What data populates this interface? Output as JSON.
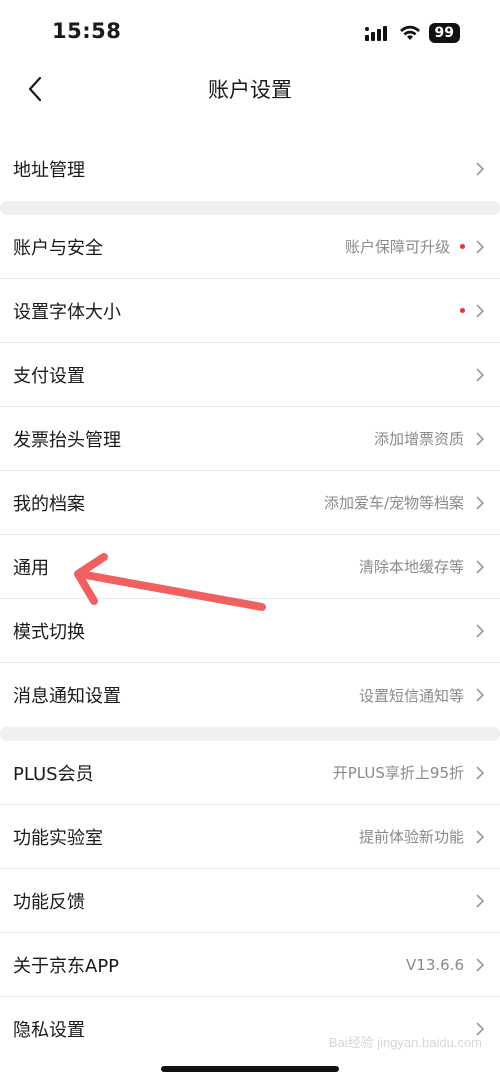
{
  "status": {
    "time": "15:58",
    "battery": "99"
  },
  "nav": {
    "title": "账户设置"
  },
  "groups": [
    {
      "rows": [
        {
          "label": "地址管理",
          "value": "",
          "dot": false
        }
      ]
    },
    {
      "rows": [
        {
          "label": "账户与安全",
          "value": "账户保障可升级",
          "dot": true
        },
        {
          "label": "设置字体大小",
          "value": "",
          "dot": true
        },
        {
          "label": "支付设置",
          "value": "",
          "dot": false
        },
        {
          "label": "发票抬头管理",
          "value": "添加增票资质",
          "dot": false
        },
        {
          "label": "我的档案",
          "value": "添加爱车/宠物等档案",
          "dot": false
        },
        {
          "label": "通用",
          "value": "清除本地缓存等",
          "dot": false
        },
        {
          "label": "模式切换",
          "value": "",
          "dot": false
        },
        {
          "label": "消息通知设置",
          "value": "设置短信通知等",
          "dot": false
        }
      ]
    },
    {
      "rows": [
        {
          "label": "PLUS会员",
          "value": "开PLUS享折上95折",
          "dot": false
        },
        {
          "label": "功能实验室",
          "value": "提前体验新功能",
          "dot": false
        },
        {
          "label": "功能反馈",
          "value": "",
          "dot": false
        },
        {
          "label": "关于京东APP",
          "value": "V13.6.6",
          "dot": false
        },
        {
          "label": "隐私设置",
          "value": "",
          "dot": false
        }
      ]
    }
  ],
  "colors": {
    "accent_red": "#e8313c",
    "arrow": "#f06060",
    "separator": "#f0f0f0"
  },
  "watermark": "Bai经验 jingyan.baidu.com"
}
